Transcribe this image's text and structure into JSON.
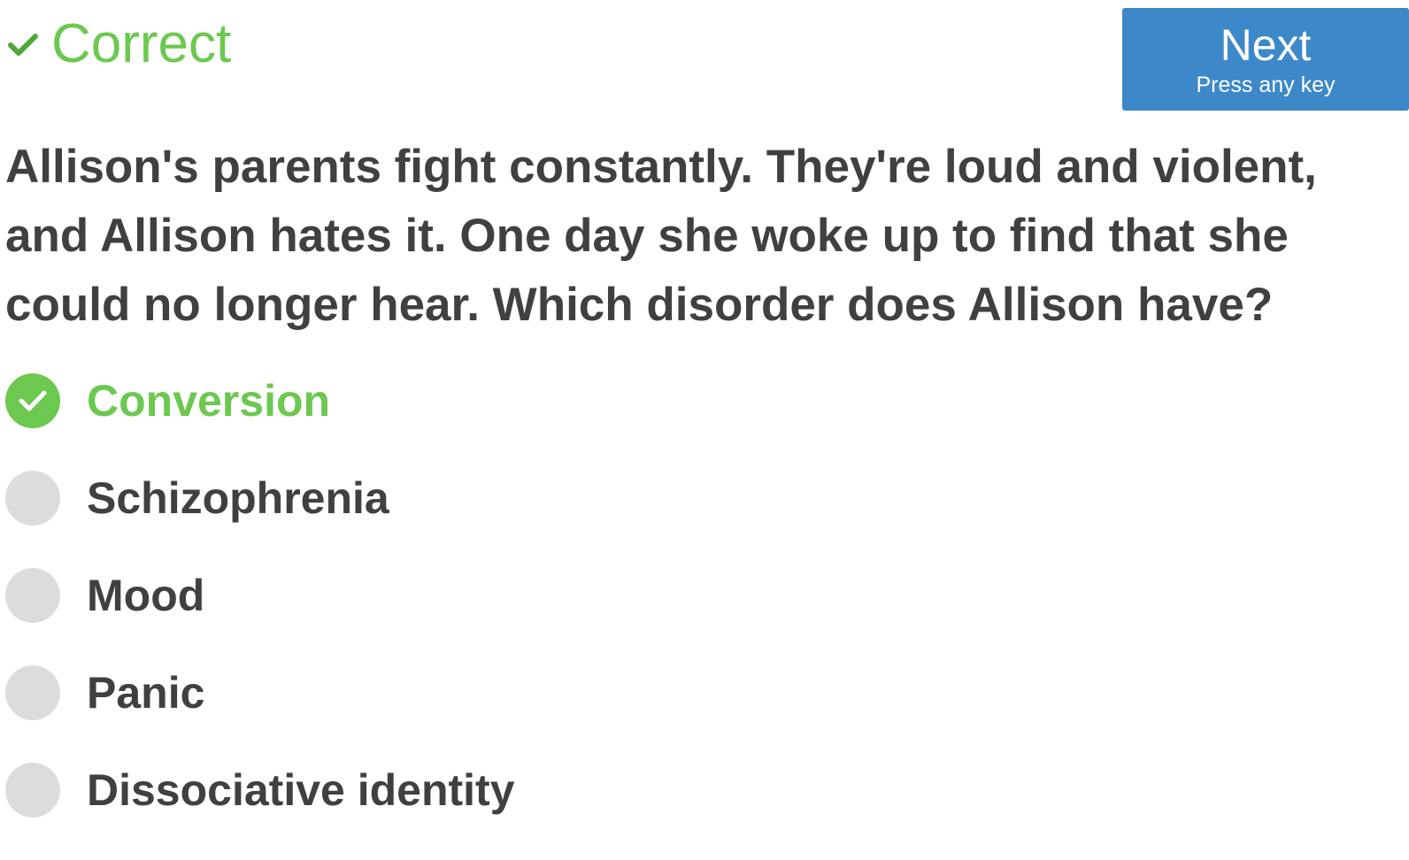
{
  "status": {
    "icon": "checkmark-icon",
    "text": "Correct",
    "color": "#6cc84f"
  },
  "next_button": {
    "label": "Next",
    "hint": "Press any key",
    "color": "#3d88c8"
  },
  "question": {
    "text": "Allison's parents fight constantly. They're loud and violent, and Allison hates it. One day she woke up to find that she could no longer hear. Which disorder does Allison have?"
  },
  "options": [
    {
      "label": "Conversion",
      "state": "correct",
      "icon": "check-circle-icon"
    },
    {
      "label": "Schizophrenia",
      "state": "unselected",
      "icon": "radio-empty-icon"
    },
    {
      "label": "Mood",
      "state": "unselected",
      "icon": "radio-empty-icon"
    },
    {
      "label": "Panic",
      "state": "unselected",
      "icon": "radio-empty-icon"
    },
    {
      "label": "Dissociative identity",
      "state": "unselected",
      "icon": "radio-empty-icon"
    }
  ]
}
